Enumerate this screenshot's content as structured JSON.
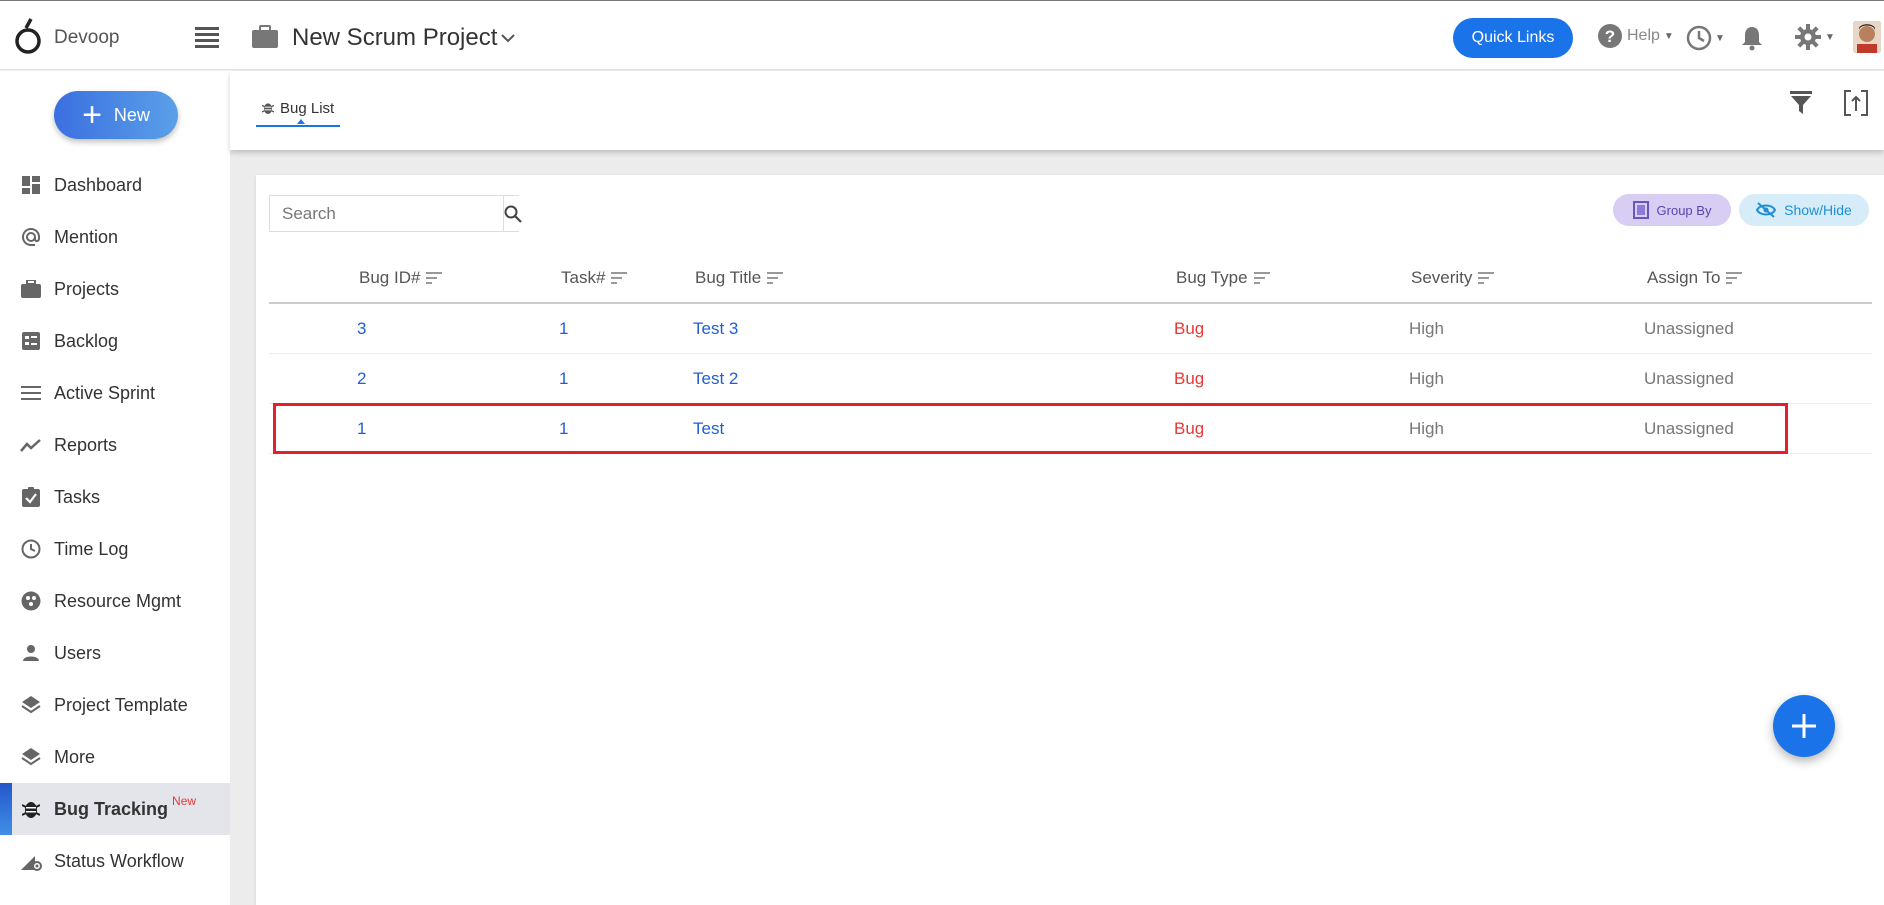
{
  "app": {
    "name": "Devoop"
  },
  "header": {
    "project_title": "New Scrum Project",
    "quick_links_label": "Quick Links",
    "help_label": "Help"
  },
  "sidebar": {
    "new_label": "New",
    "items": [
      {
        "label": "Dashboard",
        "icon": "dashboard-icon"
      },
      {
        "label": "Mention",
        "icon": "at-icon"
      },
      {
        "label": "Projects",
        "icon": "briefcase-icon"
      },
      {
        "label": "Backlog",
        "icon": "backlog-icon"
      },
      {
        "label": "Active Sprint",
        "icon": "list-icon"
      },
      {
        "label": "Reports",
        "icon": "trend-icon"
      },
      {
        "label": "Tasks",
        "icon": "task-check-icon"
      },
      {
        "label": "Time Log",
        "icon": "clock-icon"
      },
      {
        "label": "Resource Mgmt",
        "icon": "resource-icon"
      },
      {
        "label": "Users",
        "icon": "user-icon"
      },
      {
        "label": "Project Template",
        "icon": "layers-icon"
      },
      {
        "label": "More",
        "icon": "layers-icon"
      },
      {
        "label": "Bug Tracking",
        "icon": "bug-icon",
        "badge": "New",
        "active": true
      },
      {
        "label": "Status Workflow",
        "icon": "workflow-icon"
      }
    ]
  },
  "tabs": {
    "bug_list_label": "Bug List"
  },
  "toolbar": {
    "search_placeholder": "Search",
    "group_by_label": "Group By",
    "show_hide_label": "Show/Hide"
  },
  "table": {
    "columns": [
      "Bug ID#",
      "Task#",
      "Bug Title",
      "Bug Type",
      "Severity",
      "Assign To"
    ],
    "rows": [
      {
        "bug_id": "3",
        "task": "1",
        "title": "Test 3",
        "type": "Bug",
        "severity": "High",
        "assign": "Unassigned"
      },
      {
        "bug_id": "2",
        "task": "1",
        "title": "Test 2",
        "type": "Bug",
        "severity": "High",
        "assign": "Unassigned"
      },
      {
        "bug_id": "1",
        "task": "1",
        "title": "Test",
        "type": "Bug",
        "severity": "High",
        "assign": "Unassigned",
        "highlighted": true
      }
    ]
  },
  "colors": {
    "primary": "#1a73e8",
    "bug": "#e53935",
    "highlight": "#e51f2b",
    "link": "#1f5fd6"
  }
}
